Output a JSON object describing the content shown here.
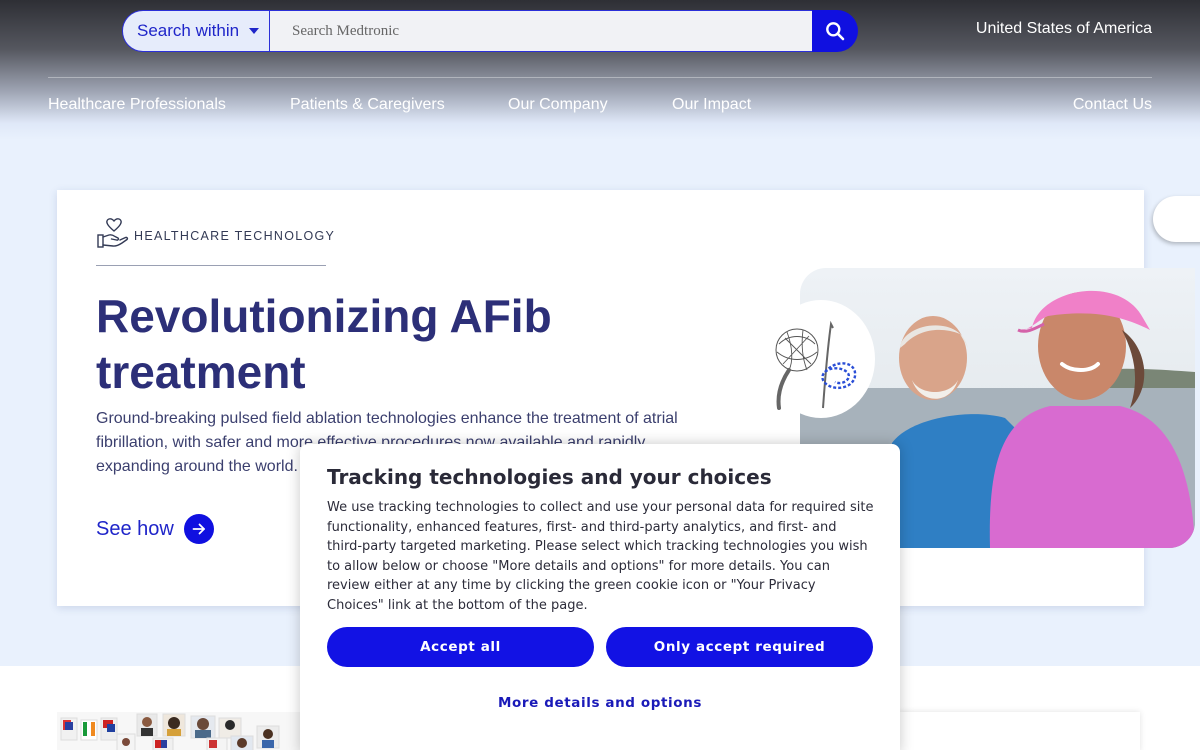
{
  "header": {
    "search_within_label": "Search within",
    "search_placeholder": "Search Medtronic",
    "region": "United States of America"
  },
  "nav": {
    "items": [
      {
        "label": "Healthcare Professionals"
      },
      {
        "label": "Patients & Caregivers"
      },
      {
        "label": "Our Company"
      },
      {
        "label": "Our Impact"
      }
    ],
    "contact": "Contact Us"
  },
  "hero": {
    "eyebrow": "HEALTHCARE TECHNOLOGY",
    "title": "Revolutionizing AFib treatment",
    "description": "Ground-breaking pulsed field ablation technologies enhance the treatment of atrial fibrillation, with safer and more effective procedures now available and rapidly expanding around the world.",
    "cta": "See how"
  },
  "cookie": {
    "title": "Tracking technologies and your choices",
    "body": "We use tracking technologies to collect and use your personal data for required site functionality, enhanced features, first- and third-party analytics, and first- and third-party targeted marketing. Please select which tracking technologies you wish to allow below or choose \"More details and options\" for more details. You can review either at any time by clicking the green cookie icon or \"Your Privacy Choices\" link at the bottom of the page.",
    "accept_all": "Accept all",
    "only_required": "Only accept required",
    "more_details": "More details and options"
  },
  "colors": {
    "accent": "#1010e0",
    "heading": "#2c2f78",
    "page_bg": "#e9f1fd"
  },
  "icons": {
    "search": "search-icon",
    "hand_heart": "hand-heart-icon",
    "arrow": "arrow-right-icon"
  }
}
